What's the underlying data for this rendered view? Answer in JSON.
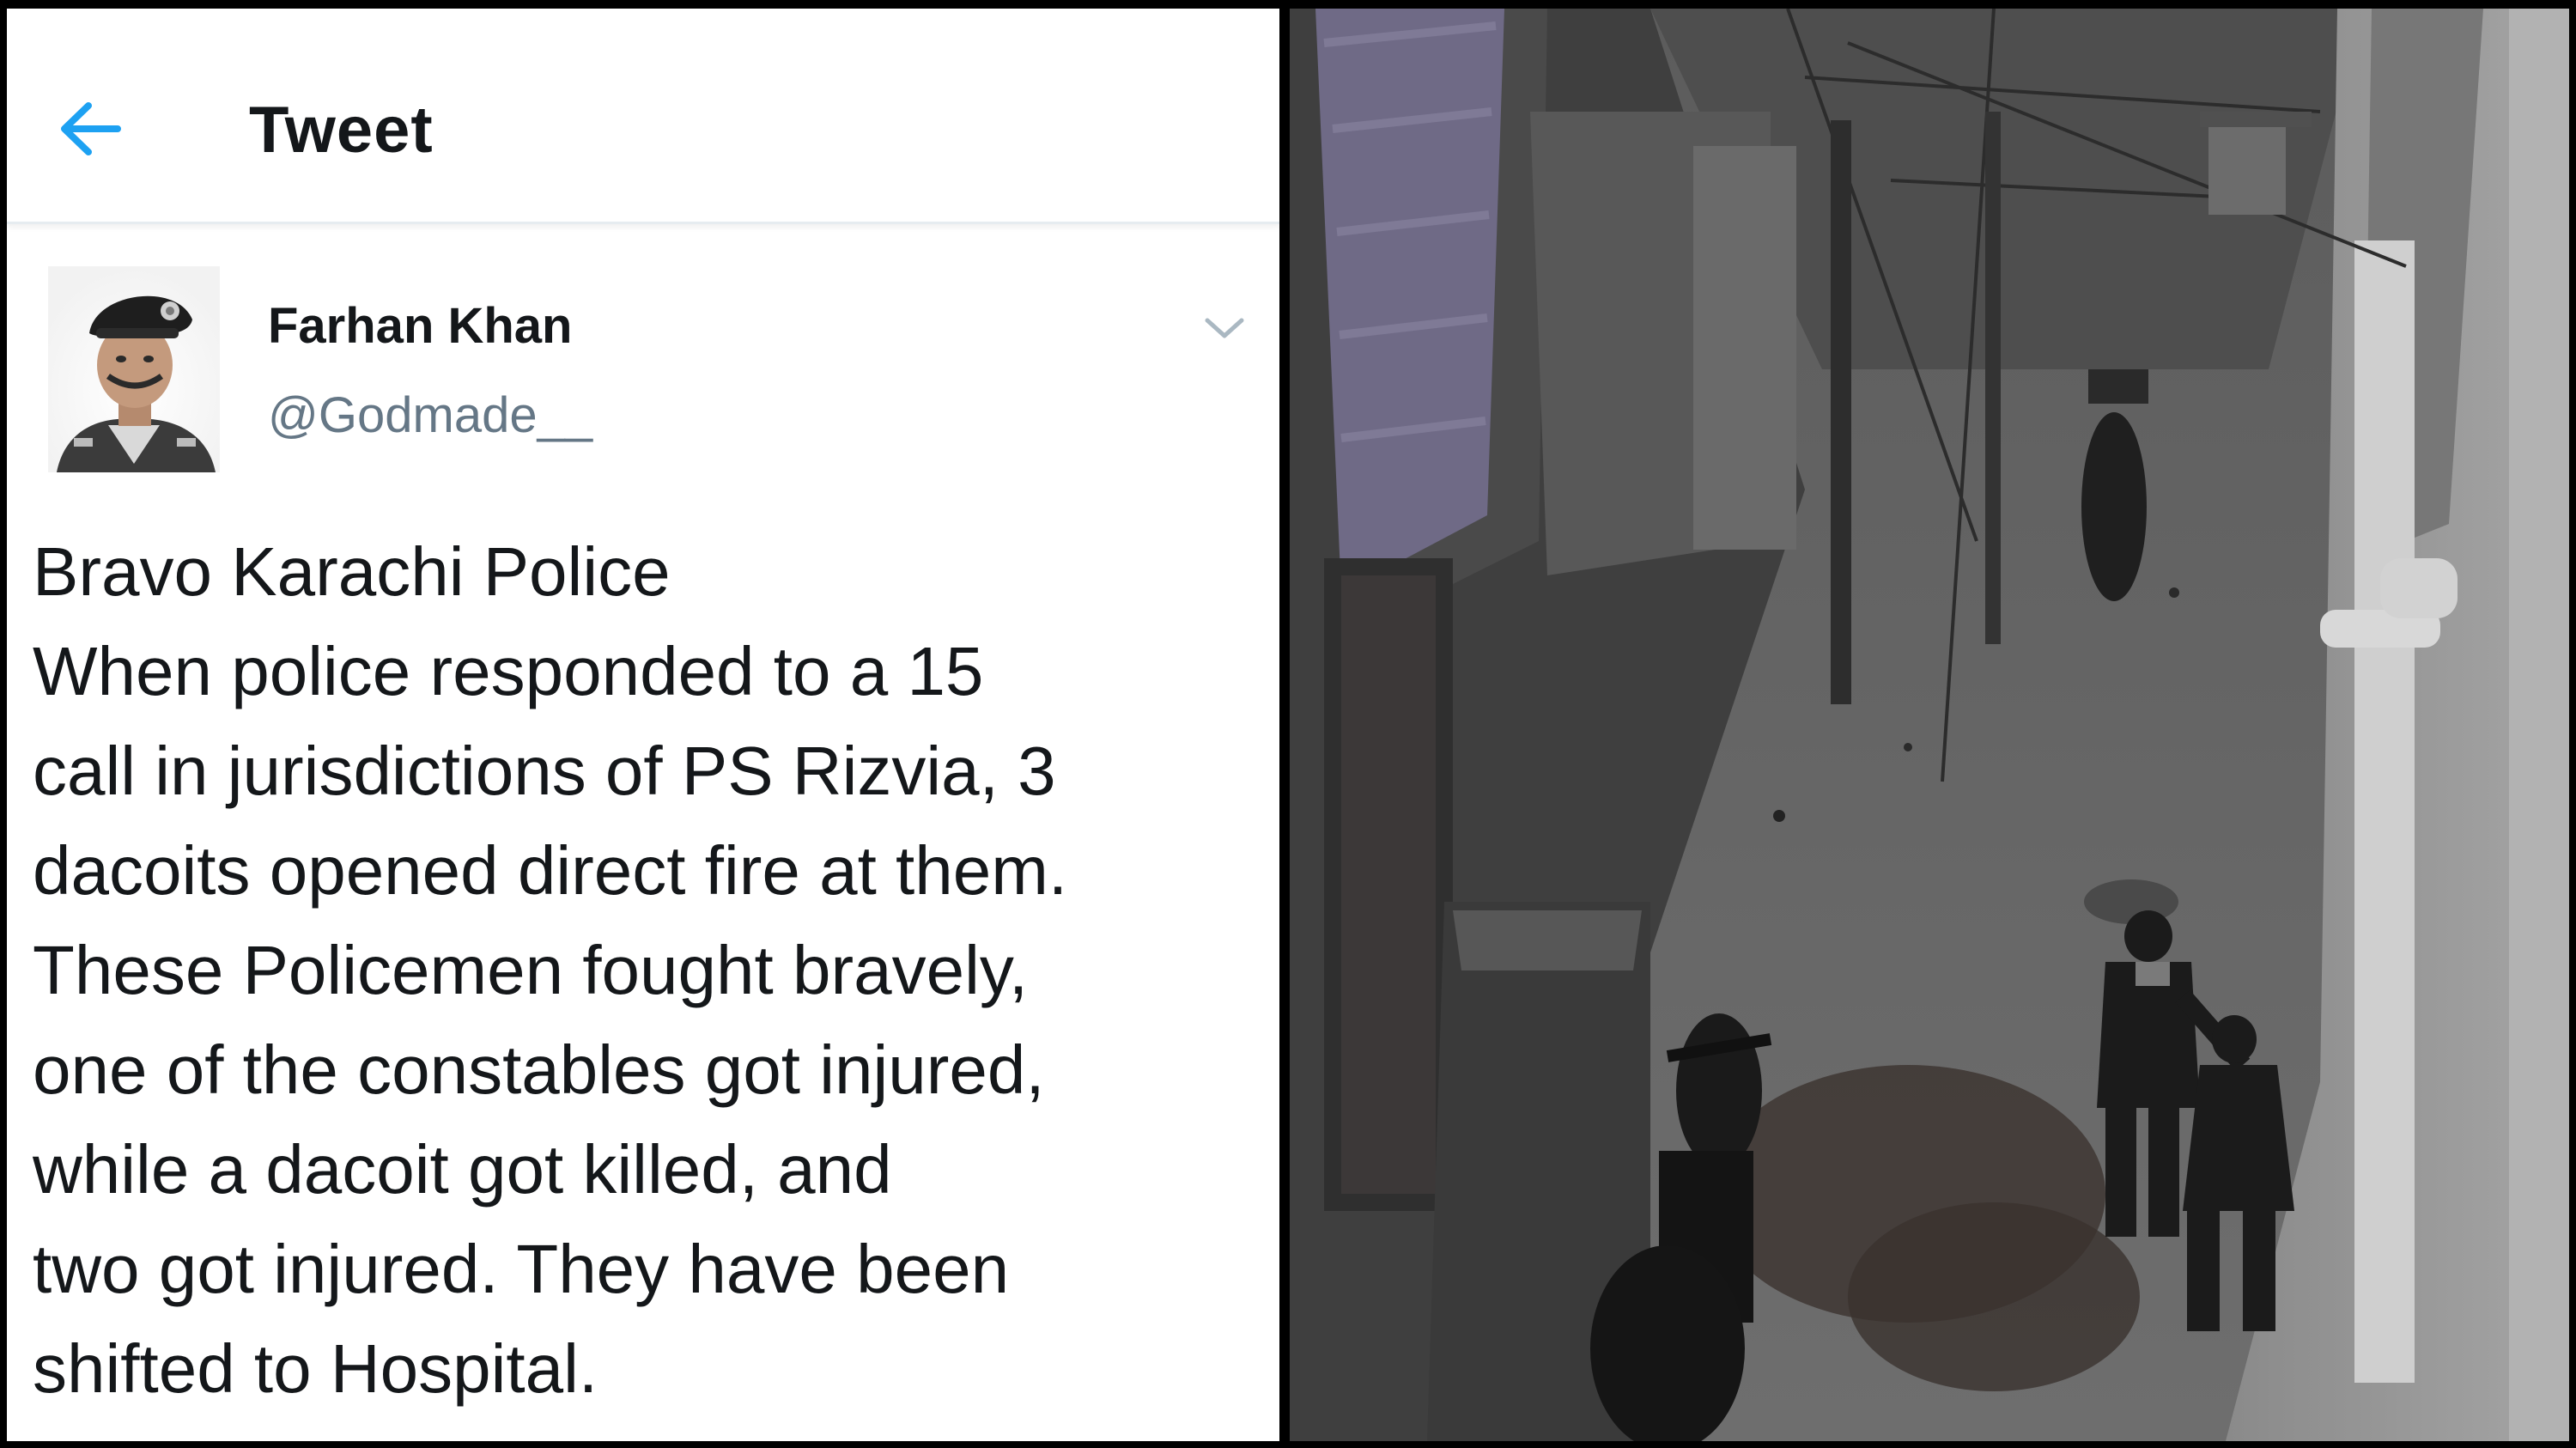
{
  "header": {
    "title": "Tweet",
    "back_icon": "arrow-left-icon",
    "accent_color": "#1da1f2"
  },
  "tweet": {
    "author_name": "Farhan Khan",
    "author_handle": "@Godmade__",
    "menu_icon": "chevron-down-icon",
    "lines": [
      "Bravo Karachi Police",
      "When police responded to a 15",
      "call in jurisdictions of PS Rizvia, 3",
      "dacoits opened direct fire at them.",
      "These Policemen fought bravely,",
      "one of the constables got injured,",
      "while a dacoit got killed, and",
      "two got injured. They have been",
      "shifted to Hospital."
    ]
  },
  "colors": {
    "text_primary": "#14171a",
    "text_secondary": "#657786",
    "divider": "#e6ecf0",
    "background": "#ffffff"
  }
}
